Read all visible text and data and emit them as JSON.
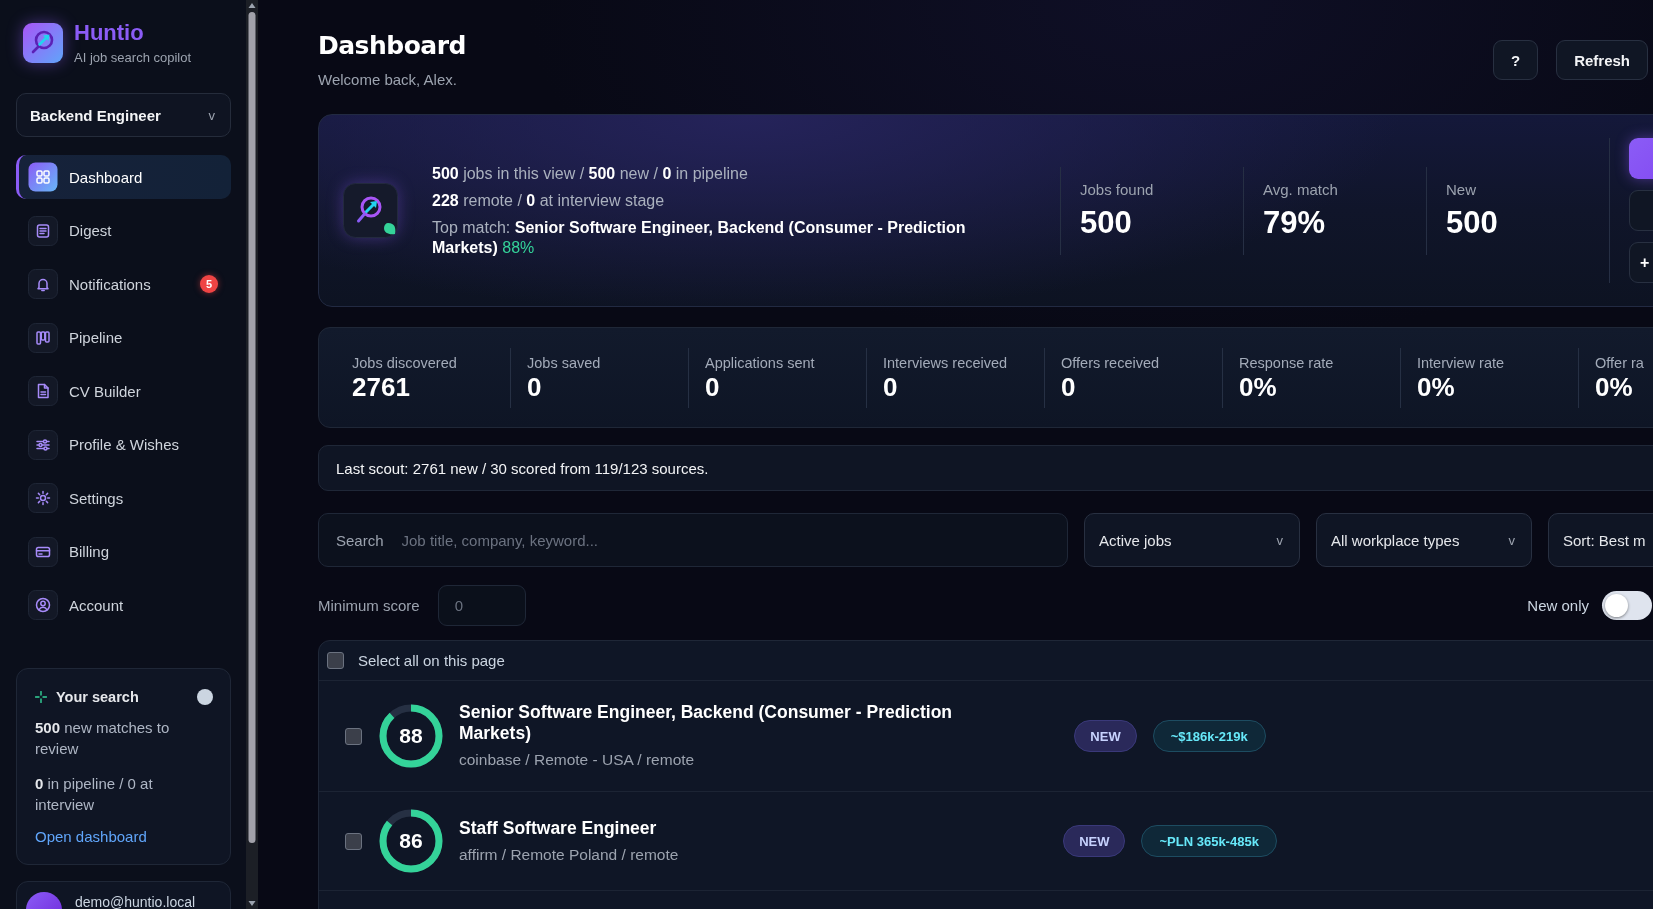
{
  "sidebar": {
    "brand": {
      "name": "Huntio",
      "tagline": "AI job search copilot"
    },
    "search_profile": {
      "value": "Backend Engineer",
      "caret": "v"
    },
    "nav": [
      {
        "label": "Dashboard",
        "selected": true
      },
      {
        "label": "Digest",
        "selected": false
      },
      {
        "label": "Notifications",
        "selected": false,
        "badge": "5"
      },
      {
        "label": "Pipeline",
        "selected": false
      },
      {
        "label": "CV Builder",
        "selected": false
      },
      {
        "label": "Profile & Wishes",
        "selected": false
      },
      {
        "label": "Settings",
        "selected": false
      },
      {
        "label": "Billing",
        "selected": false
      },
      {
        "label": "Account",
        "selected": false
      }
    ],
    "search_card": {
      "title": "Your search",
      "lines": [
        "**500** new matches to review",
        "**0** in pipeline / 0 at interview"
      ],
      "link": "Open dashboard"
    },
    "user": {
      "email": "demo@huntio.local"
    }
  },
  "header": {
    "title": "Dashboard",
    "subtitle": "Welcome back, Alex.",
    "buttons": [
      "?",
      "Refresh"
    ]
  },
  "hero": {
    "summary": [
      "**500** jobs in this view / **500** new / **0** in pipeline",
      "**228** remote / **0** at interview stage"
    ],
    "top_match": {
      "label": "Top match:",
      "title": "Senior Software Engineer, Backend (Consumer - Prediction Markets)",
      "score": "88%"
    },
    "stats": [
      {
        "label": "Jobs found",
        "value": "500"
      },
      {
        "label": "Avg. match",
        "value": "79%"
      },
      {
        "label": "New",
        "value": "500"
      }
    ],
    "actions": [
      {
        "kind": "primary"
      },
      {
        "kind": "secondary"
      },
      {
        "kind": "secondary",
        "label": "+"
      }
    ]
  },
  "metrics": [
    {
      "label": "Jobs discovered",
      "value": "2761"
    },
    {
      "label": "Jobs saved",
      "value": "0"
    },
    {
      "label": "Applications sent",
      "value": "0"
    },
    {
      "label": "Interviews received",
      "value": "0"
    },
    {
      "label": "Offers received",
      "value": "0"
    },
    {
      "label": "Response rate",
      "value": "0%"
    },
    {
      "label": "Interview rate",
      "value": "0%"
    },
    {
      "label": "Offer ra",
      "value": "0%"
    }
  ],
  "scout_status": "Last scout: 2761 new / 30 scored from 119/123 sources.",
  "filters": {
    "search": {
      "label": "Search",
      "placeholder": "Job title, company, keyword..."
    },
    "selects": [
      {
        "value": "Active jobs",
        "caret": "v"
      },
      {
        "value": "All workplace types",
        "caret": "v"
      },
      {
        "value": "Sort: Best m"
      }
    ],
    "minimum_score": {
      "label": "Minimum score",
      "placeholder": "0"
    },
    "new_only": {
      "label": "New only",
      "on": false
    }
  },
  "jobs": {
    "select_all": {
      "label": "Select all on this page",
      "checked": false
    },
    "rows": [
      {
        "checked": false,
        "score": "88",
        "level": 0.88,
        "title": "Senior Software Engineer, Backend (Consumer - Prediction Markets)",
        "meta": "coinbase / Remote - USA / remote",
        "tags": [
          {
            "kind": "new",
            "text": "NEW"
          },
          {
            "kind": "salary",
            "text": "~$186k-219k"
          }
        ]
      },
      {
        "checked": false,
        "score": "86",
        "level": 0.86,
        "title": "Staff Software Engineer",
        "meta": "affirm / Remote Poland / remote",
        "tags": [
          {
            "kind": "new",
            "text": "NEW"
          },
          {
            "kind": "salary",
            "text": "~PLN 365k-485k"
          }
        ]
      }
    ]
  }
}
